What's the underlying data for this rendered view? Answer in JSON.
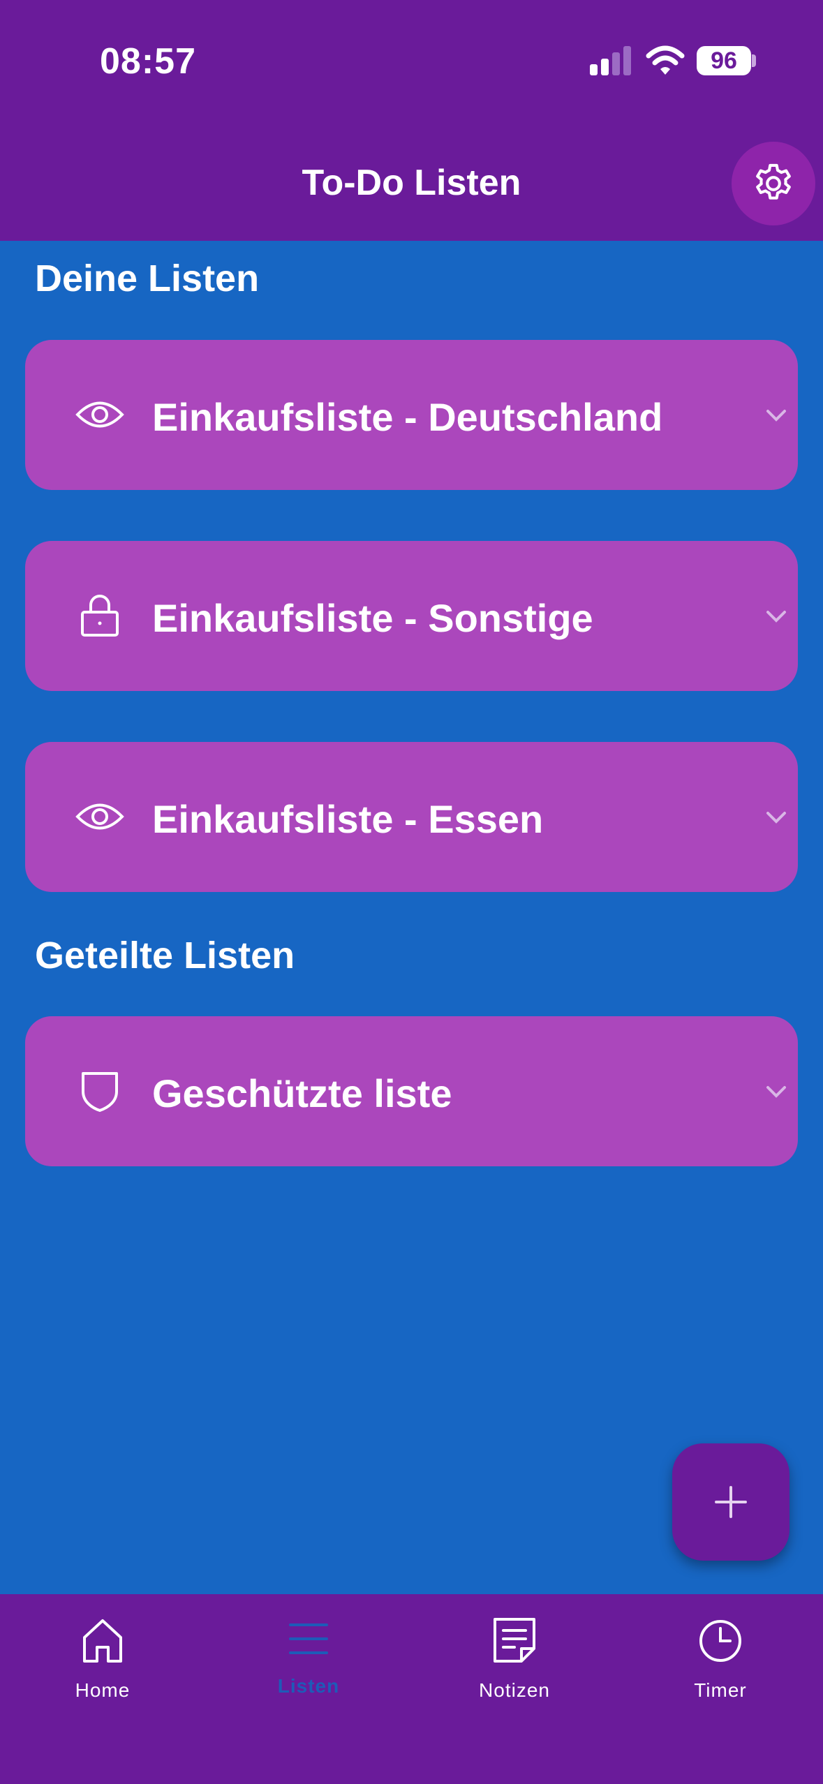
{
  "status_bar": {
    "time": "08:57",
    "battery": "96"
  },
  "app_bar": {
    "title": "To-Do Listen",
    "settings_icon": "gear-icon"
  },
  "sections": {
    "own": {
      "title": "Deine Listen",
      "items": [
        {
          "label": "Einkaufsliste - Deutschland",
          "icon": "eye-icon"
        },
        {
          "label": "Einkaufsliste - Sonstige",
          "icon": "lock-icon"
        },
        {
          "label": "Einkaufsliste - Essen",
          "icon": "eye-icon"
        }
      ]
    },
    "shared": {
      "title": "Geteilte Listen",
      "items": [
        {
          "label": "Geschützte liste",
          "icon": "shield-icon"
        }
      ]
    }
  },
  "fab": {
    "icon": "plus-icon"
  },
  "bottom_nav": {
    "active": "Listen",
    "items": [
      {
        "label": "Home",
        "icon": "home-icon"
      },
      {
        "label": "Listen",
        "icon": "list-icon"
      },
      {
        "label": "Notizen",
        "icon": "note-icon"
      },
      {
        "label": "Timer",
        "icon": "clock-icon"
      }
    ]
  },
  "colors": {
    "background": "#1766C3",
    "bars": "#6A1B9A",
    "card": "#AB47BC",
    "active_nav": "#1E5BB8"
  }
}
